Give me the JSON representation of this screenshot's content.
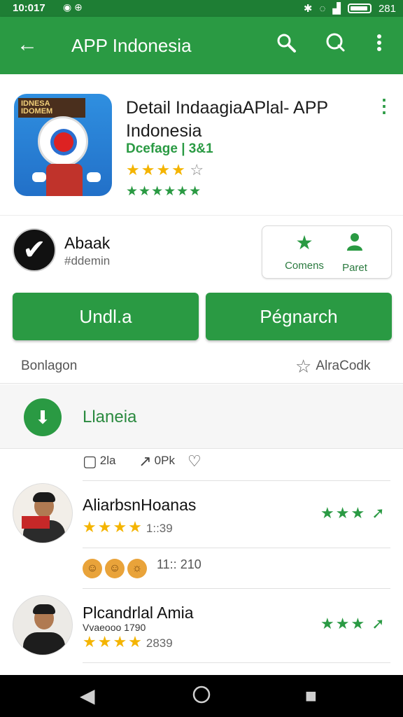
{
  "status_bar": {
    "time": "10:017",
    "right_text": "281",
    "icons": [
      "notification-icon",
      "bluetooth-icon",
      "wifi-icon",
      "signal-icon",
      "battery-icon"
    ]
  },
  "app_bar": {
    "title": "APP Indonesia",
    "back_icon": "arrow-left-icon",
    "actions": [
      "search-icon",
      "search-icon",
      "more-vert-icon"
    ]
  },
  "app": {
    "icon_banner": "IDNESA IDOMEM",
    "name": "Detail IndaagiaAPlal- APP Indonesia",
    "meta": "Dcefage | 3&1",
    "rating_stars": "★★★★",
    "rating_half": "☆",
    "rating_row2": "★★★★★★"
  },
  "developer": {
    "name": "Abaak",
    "handle": "#ddemin"
  },
  "action_card": {
    "items": [
      {
        "label": "Comens",
        "icon": "star-icon"
      },
      {
        "label": "Paret",
        "icon": "person-icon"
      }
    ]
  },
  "buttons": {
    "primary": "Undl.a",
    "secondary": "Pégnarch"
  },
  "info": {
    "left": "Bonlagon",
    "right": "AlraCodk"
  },
  "section": {
    "title": "Llaneia",
    "icon": "download-icon"
  },
  "stats": {
    "comments": "2la",
    "shares": "0Pk"
  },
  "reviews": [
    {
      "name": "AliarbsnHoanas",
      "stars": "★★★★",
      "meta": "1::39",
      "right_stars": "★★★",
      "reactions_count": "11:: 210"
    },
    {
      "name": "Plcandrlal Amia",
      "subtitle": "Vvaeooo 1790",
      "stars": "★★★★",
      "meta": "2839",
      "right_stars": "★★★"
    }
  ],
  "colors": {
    "primary": "#2a9a43",
    "statusbar": "#1e7e34",
    "star": "#f4b400"
  }
}
